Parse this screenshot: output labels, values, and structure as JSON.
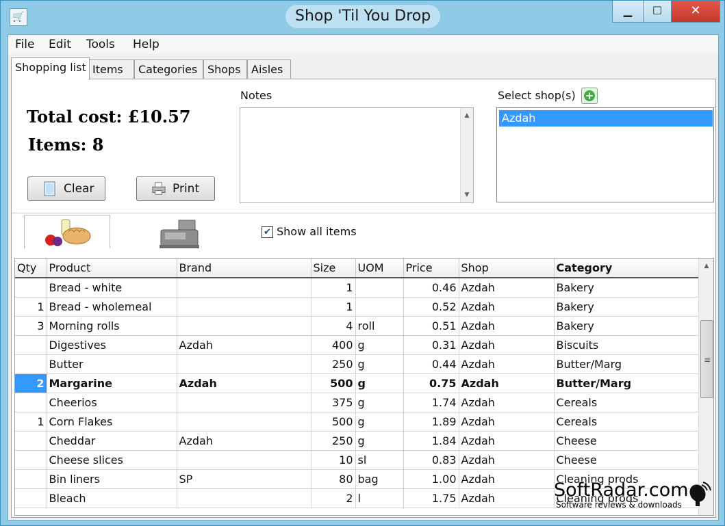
{
  "window": {
    "title": "Shop 'Til You Drop",
    "minimize_glyph": "▁",
    "maximize_glyph": "☐",
    "close_glyph": "✕",
    "app_icon": "cart-icon"
  },
  "menu": [
    "File",
    "Edit",
    "Tools",
    "Help"
  ],
  "tabs": [
    "Shopping list",
    "Items",
    "Categories",
    "Shops",
    "Aisles"
  ],
  "summary": {
    "total_cost": "Total cost: £10.57",
    "items": "Items: 8"
  },
  "buttons": {
    "clear": "Clear",
    "print": "Print"
  },
  "notes": {
    "label": "Notes",
    "value": ""
  },
  "shops": {
    "label": "Select shop(s)",
    "selected": [
      "Azdah"
    ]
  },
  "view_tabs": {
    "tab1_icon": "groceries-icon",
    "tab2_icon": "cash-register-icon"
  },
  "show_all": {
    "label": "Show all items",
    "checked": true,
    "check_glyph": "✔"
  },
  "grid": {
    "columns": [
      "Qty",
      "Product",
      "Brand",
      "Size",
      "UOM",
      "Price",
      "Shop",
      "Category"
    ],
    "rows": [
      {
        "qty": "",
        "product": "Bread - white",
        "brand": "",
        "size": "1",
        "uom": "",
        "price": "0.46",
        "shop": "Azdah",
        "category": "Bakery"
      },
      {
        "qty": "1",
        "product": "Bread - wholemeal",
        "brand": "",
        "size": "1",
        "uom": "",
        "price": "0.52",
        "shop": "Azdah",
        "category": "Bakery"
      },
      {
        "qty": "3",
        "product": "Morning rolls",
        "brand": "",
        "size": "4",
        "uom": "roll",
        "price": "0.51",
        "shop": "Azdah",
        "category": "Bakery"
      },
      {
        "qty": "",
        "product": "Digestives",
        "brand": "Azdah",
        "size": "400",
        "uom": "g",
        "price": "0.31",
        "shop": "Azdah",
        "category": "Biscuits"
      },
      {
        "qty": "",
        "product": "Butter",
        "brand": "",
        "size": "250",
        "uom": "g",
        "price": "0.44",
        "shop": "Azdah",
        "category": "Butter/Marg"
      },
      {
        "qty": "2",
        "product": "Margarine",
        "brand": "Azdah",
        "size": "500",
        "uom": "g",
        "price": "0.75",
        "shop": "Azdah",
        "category": "Butter/Marg",
        "selected": true
      },
      {
        "qty": "",
        "product": "Cheerios",
        "brand": "",
        "size": "375",
        "uom": "g",
        "price": "1.74",
        "shop": "Azdah",
        "category": "Cereals"
      },
      {
        "qty": "1",
        "product": "Corn Flakes",
        "brand": "",
        "size": "500",
        "uom": "g",
        "price": "1.89",
        "shop": "Azdah",
        "category": "Cereals"
      },
      {
        "qty": "",
        "product": "Cheddar",
        "brand": "Azdah",
        "size": "250",
        "uom": "g",
        "price": "1.84",
        "shop": "Azdah",
        "category": "Cheese"
      },
      {
        "qty": "",
        "product": "Cheese slices",
        "brand": "",
        "size": "10",
        "uom": "sl",
        "price": "0.83",
        "shop": "Azdah",
        "category": "Cheese"
      },
      {
        "qty": "",
        "product": "Bin liners",
        "brand": "SP",
        "size": "80",
        "uom": "bag",
        "price": "1.00",
        "shop": "Azdah",
        "category": "Cleaning prods"
      },
      {
        "qty": "",
        "product": "Bleach",
        "brand": "",
        "size": "2",
        "uom": "l",
        "price": "1.75",
        "shop": "Azdah",
        "category": "Cleaning prods"
      }
    ]
  },
  "watermark": {
    "main": "SoftRadar.com",
    "sub": "Software reviews & downloads"
  },
  "colors": {
    "selection": "#3399ff",
    "title_bar": "#8fcbe6",
    "close": "#c3392b"
  }
}
